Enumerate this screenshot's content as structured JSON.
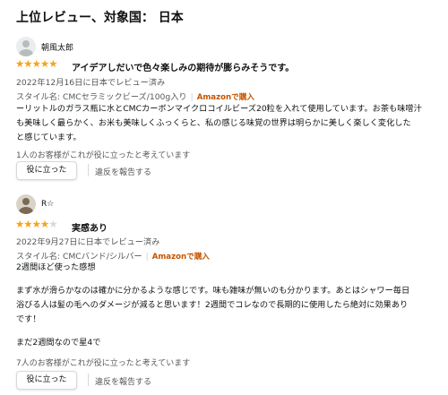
{
  "heading": "上位レビュー、対象国： 日本",
  "reviews": [
    {
      "reviewer": "朝風太郎",
      "rating": 5,
      "stars_text": "★★★★★",
      "stars_empty": "",
      "title": "アイデアしだいで色々楽しみの期待が膨らみそうです。",
      "date": "2022年12月16日に日本でレビュー済み",
      "variant": "スタイル名: CMCセラミックビーズ/100g入り",
      "badge": "Amazonで購入",
      "body_lines": [
        "ーリットルのガラス瓶に水とCMCカーボンマイクロコイルビーズ20粒を入れて使用しています。お茶も味噌汁",
        "も美味しく最らかく、お米も美味しくふっくらと、私の感じる味覚の世界は明らかに美しく楽しく変化した",
        "と感じています。"
      ],
      "helpful": "1人のお客様がこれが役に立ったと考えています",
      "helpful_button": "役に立った",
      "report": "違反を報告する"
    },
    {
      "reviewer": "R☆",
      "rating": 4,
      "stars_text": "★★★★",
      "stars_empty": "★",
      "title": "実感あり",
      "date": "2022年9月27日に日本でレビュー済み",
      "variant": "スタイル名: CMCバンド/シルバー",
      "badge": "Amazonで購入",
      "body_lines": [
        "2週間ほど使った感想",
        "",
        "まず水が滑らかなのは確かに分かるような感じです。味も雑味が無いのも分かります。あとはシャワー毎日",
        "浴びる人は髪の毛へのダメージが減ると思います！2週間でコレなので長期的に使用したら絶対に効果あり",
        "です！",
        "",
        "まだ2週間なので星4で"
      ],
      "helpful": "7人のお客様がこれが役に立ったと考えています",
      "helpful_button": "役に立った",
      "report": "違反を報告する"
    }
  ],
  "colors": {
    "star": "#f7a31c",
    "badge": "#c45500",
    "meta": "#565959"
  }
}
